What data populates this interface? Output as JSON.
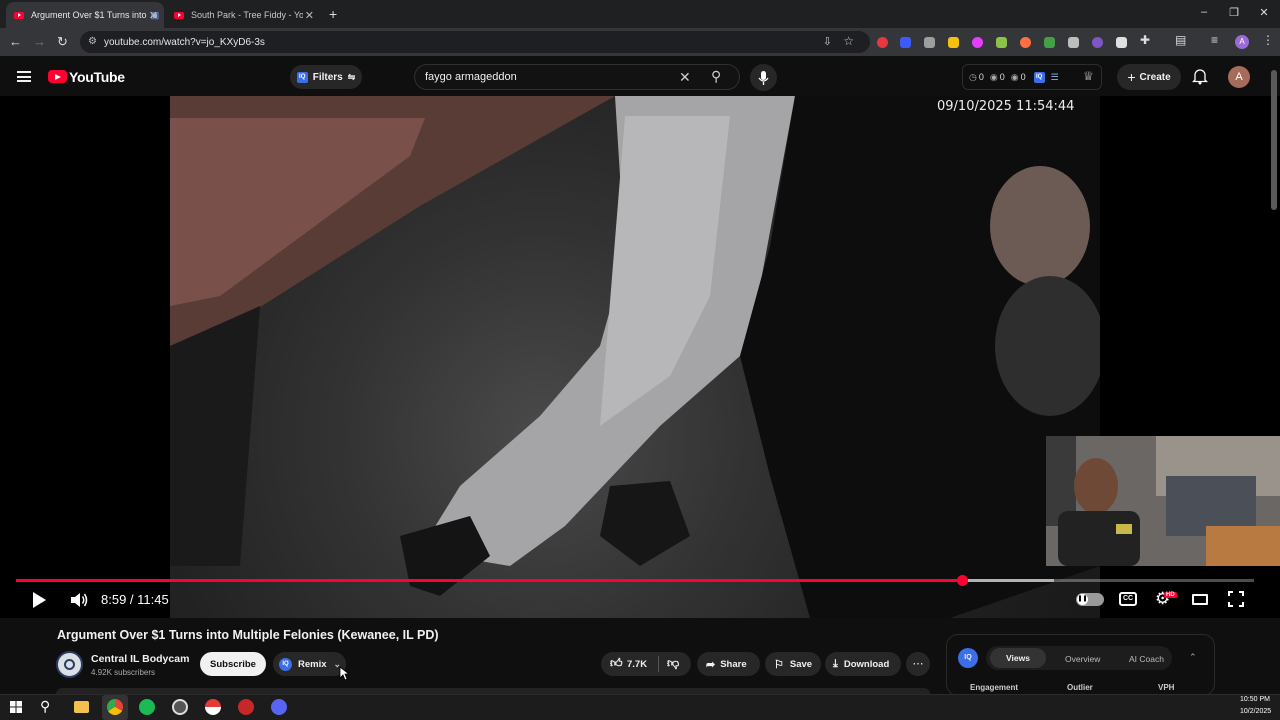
{
  "browser": {
    "tabs": [
      {
        "title": "Argument Over $1 Turns into",
        "active": true
      },
      {
        "title": "South Park - Tree Fiddy - YouTube",
        "active": false
      }
    ],
    "new_tab": "+",
    "address": "youtube.com/watch?v=jo_KXyD6-3s",
    "window_controls": [
      "–",
      "❐",
      "✕"
    ]
  },
  "youtube": {
    "logo_text": "YouTube",
    "filters_label": "Filters",
    "search_value": "faygo armageddon",
    "stats": [
      "0",
      "0",
      "0"
    ],
    "create_label": "Create",
    "avatar_letter": "A"
  },
  "video": {
    "timestamp_overlay": "09/10/2025 11:54:44",
    "time_current": "8:59",
    "time_total": "11:45",
    "time_display": "8:59 / 11:45",
    "progress_fraction": 0.7643,
    "buffered_fraction": 0.8384,
    "title": "Argument Over $1 Turns into Multiple Felonies (Kewanee, IL PD)",
    "hd_badge": "HD"
  },
  "channel": {
    "name": "Central IL Bodycam",
    "subscribers": "4.92K subscribers",
    "subscribe_label": "Subscribe",
    "remix_label": "Remix"
  },
  "actions": {
    "likes": "7.7K",
    "share": "Share",
    "save": "Save",
    "download": "Download"
  },
  "panel": {
    "tabs": [
      "Views",
      "Overview",
      "AI Coach"
    ],
    "columns": [
      "Engagement",
      "Outlier",
      "VPH"
    ],
    "badge": "IQ"
  },
  "taskbar": {
    "time": "10:50 PM",
    "date": "10/2/2025"
  },
  "colors": {
    "accent_red": "#ff0033",
    "vidiq_blue": "#3b6ee8",
    "background": "#0f0f0f"
  }
}
